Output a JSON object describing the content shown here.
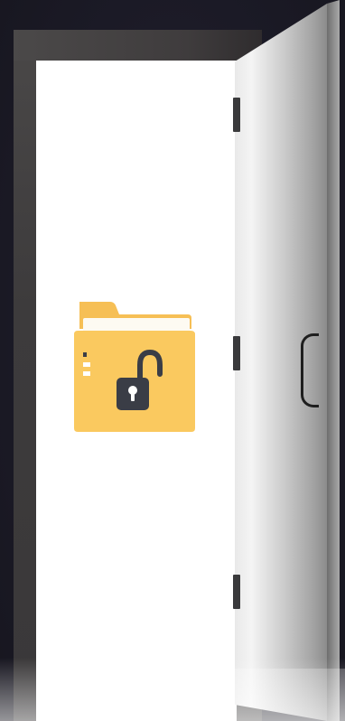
{
  "scene": {
    "illustration": "open-door-with-unlocked-folder",
    "colors": {
      "background": "#1b1a26",
      "frame": "#3d3b3c",
      "opening": "#ffffff",
      "door_light": "#f0f0f0",
      "door_dark": "#8a8a8a",
      "folder": "#fac95f",
      "folder_back": "#f5bd4f",
      "lock": "#3a3d46"
    },
    "icons": {
      "folder": "folder-icon",
      "lock": "unlocked-padlock-icon",
      "keyhole": "keyhole-icon",
      "door": "door-icon",
      "handle": "door-handle-icon"
    }
  }
}
